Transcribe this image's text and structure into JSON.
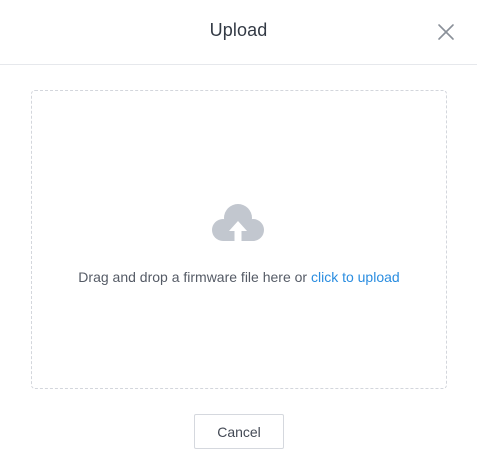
{
  "dialog": {
    "title": "Upload",
    "close_icon": "close-icon",
    "dropzone": {
      "icon": "cloud-upload-icon",
      "hint_text": "Drag and drop a firmware file here or",
      "link_text": "click to upload"
    },
    "cancel_label": "Cancel"
  },
  "colors": {
    "link": "#2a8de0",
    "icon": "#c2c7cf",
    "border": "#d3d6dc",
    "title": "#333a45"
  }
}
